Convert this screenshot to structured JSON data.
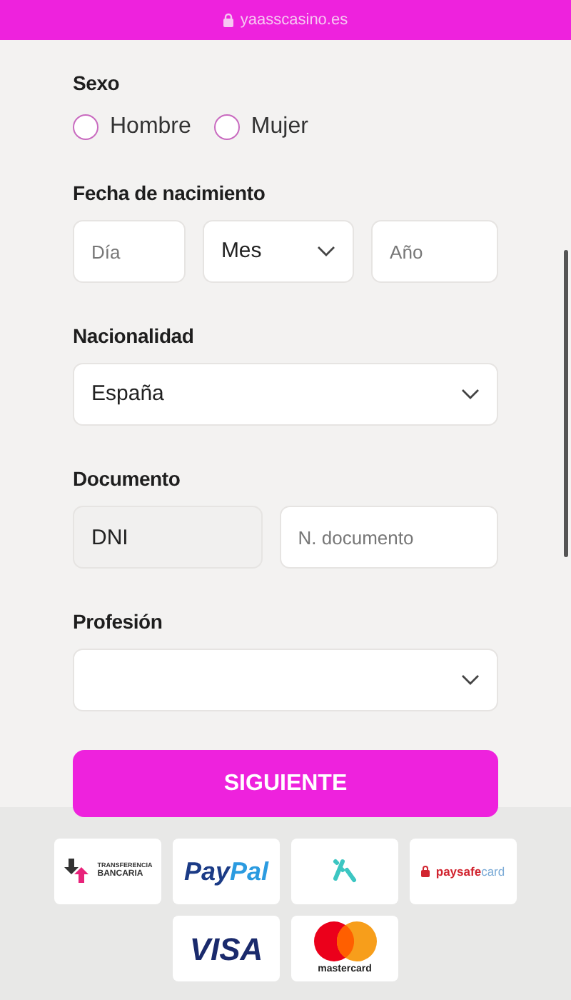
{
  "browser_bar": {
    "url": "yaasscasino.es"
  },
  "form": {
    "sexo": {
      "label": "Sexo",
      "options": [
        {
          "label": "Hombre",
          "selected": false
        },
        {
          "label": "Mujer",
          "selected": false
        }
      ]
    },
    "fecha": {
      "label": "Fecha de nacimiento",
      "fields": [
        {
          "kind": "input",
          "placeholder": "Día"
        },
        {
          "kind": "select",
          "value": "Mes"
        },
        {
          "kind": "input",
          "placeholder": "Año"
        }
      ]
    },
    "nacionalidad": {
      "label": "Nacionalidad",
      "fields": [
        {
          "kind": "select",
          "value": "España"
        }
      ]
    },
    "documento": {
      "label": "Documento",
      "fields": [
        {
          "kind": "input",
          "value": "DNI",
          "disabled": true
        },
        {
          "kind": "input",
          "placeholder": "N. documento",
          "disabled": false
        }
      ]
    },
    "profesion": {
      "label": "Profesión",
      "fields": [
        {
          "kind": "select"
        }
      ]
    },
    "submit": "SIGUIENTE"
  },
  "payment_methods": [
    {
      "kind": "transfer",
      "lines": [
        "TRANSFERENCIA",
        "BANCARIA"
      ]
    },
    {
      "kind": "paypal",
      "parts": [
        "Pay",
        "Pal"
      ]
    },
    {
      "kind": "zimpler"
    },
    {
      "kind": "paysafecard",
      "parts": [
        "paysafe",
        "card"
      ]
    },
    {
      "kind": "visa",
      "text": "VISA"
    },
    {
      "kind": "mastercard",
      "text": "mastercard"
    }
  ]
}
